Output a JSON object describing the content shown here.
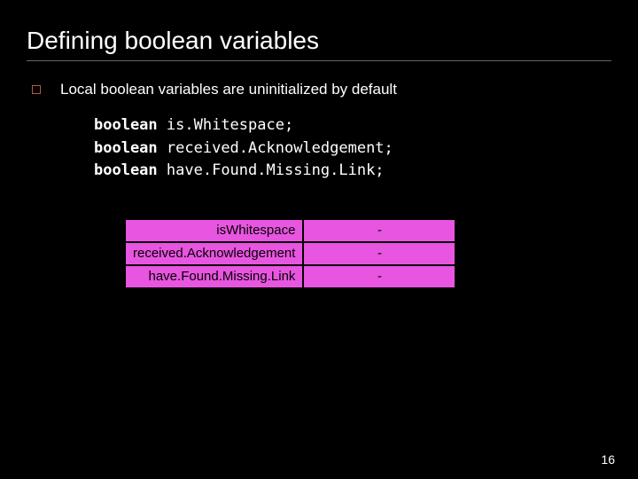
{
  "title": "Defining boolean variables",
  "bullet": "Local boolean variables are uninitialized by default",
  "code": {
    "kw": "boolean",
    "lines": [
      "is.Whitespace;",
      "received.Acknowledgement;",
      "have.Found.Missing.Link;"
    ]
  },
  "vars": [
    {
      "name": "isWhitespace",
      "value": "-"
    },
    {
      "name": "received.Acknowledgement",
      "value": "-"
    },
    {
      "name": "have.Found.Missing.Link",
      "value": "-"
    }
  ],
  "page": "16"
}
